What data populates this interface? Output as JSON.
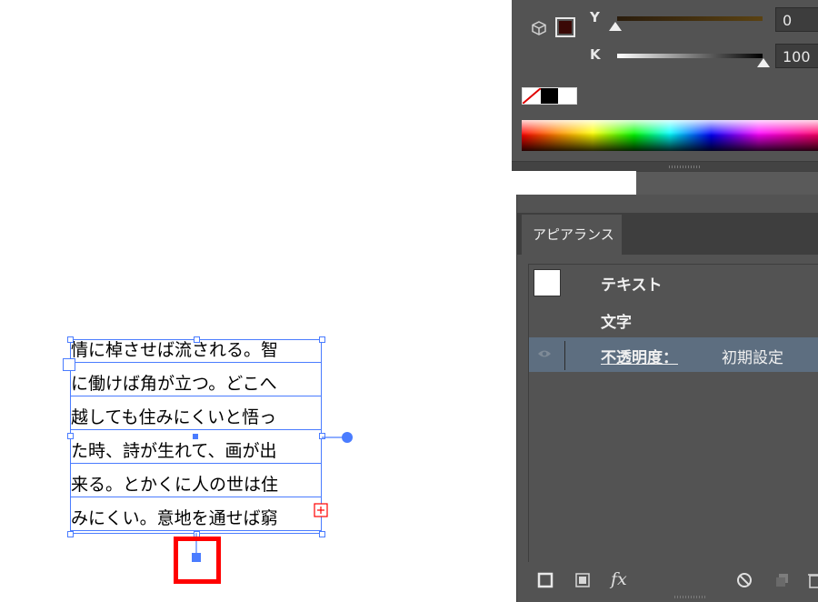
{
  "color_panel": {
    "channels": [
      {
        "label": "Y",
        "value": "0"
      },
      {
        "label": "K",
        "value": "100"
      }
    ],
    "fill_color": "#3a0906",
    "icons": [
      "cube-icon",
      "none-swatch",
      "black-swatch",
      "white-swatch",
      "color-spectrum"
    ]
  },
  "appearance_panel": {
    "tab_label": "アピアランス",
    "rows": [
      {
        "label": "テキスト"
      },
      {
        "label": "文字"
      },
      {
        "label": "不透明度：",
        "value": "初期設定"
      }
    ],
    "footer_icons": [
      "new-stroke-icon",
      "new-fill-icon",
      "fx-icon",
      "clear-appearance-icon",
      "duplicate-item-icon",
      "delete-item-icon"
    ],
    "fx_label": "fx"
  },
  "artboard": {
    "text_lines": [
      "情に棹させば流される。智",
      "に働けば角が立つ。どこへ",
      "越しても住みにくいと悟っ",
      "た時、詩が生れて、画が出",
      "来る。とかくに人の世は住",
      "みにくい。意地を通せば窮"
    ],
    "selection_color": "#4a7cff",
    "highlight_color": "#ff0000"
  }
}
